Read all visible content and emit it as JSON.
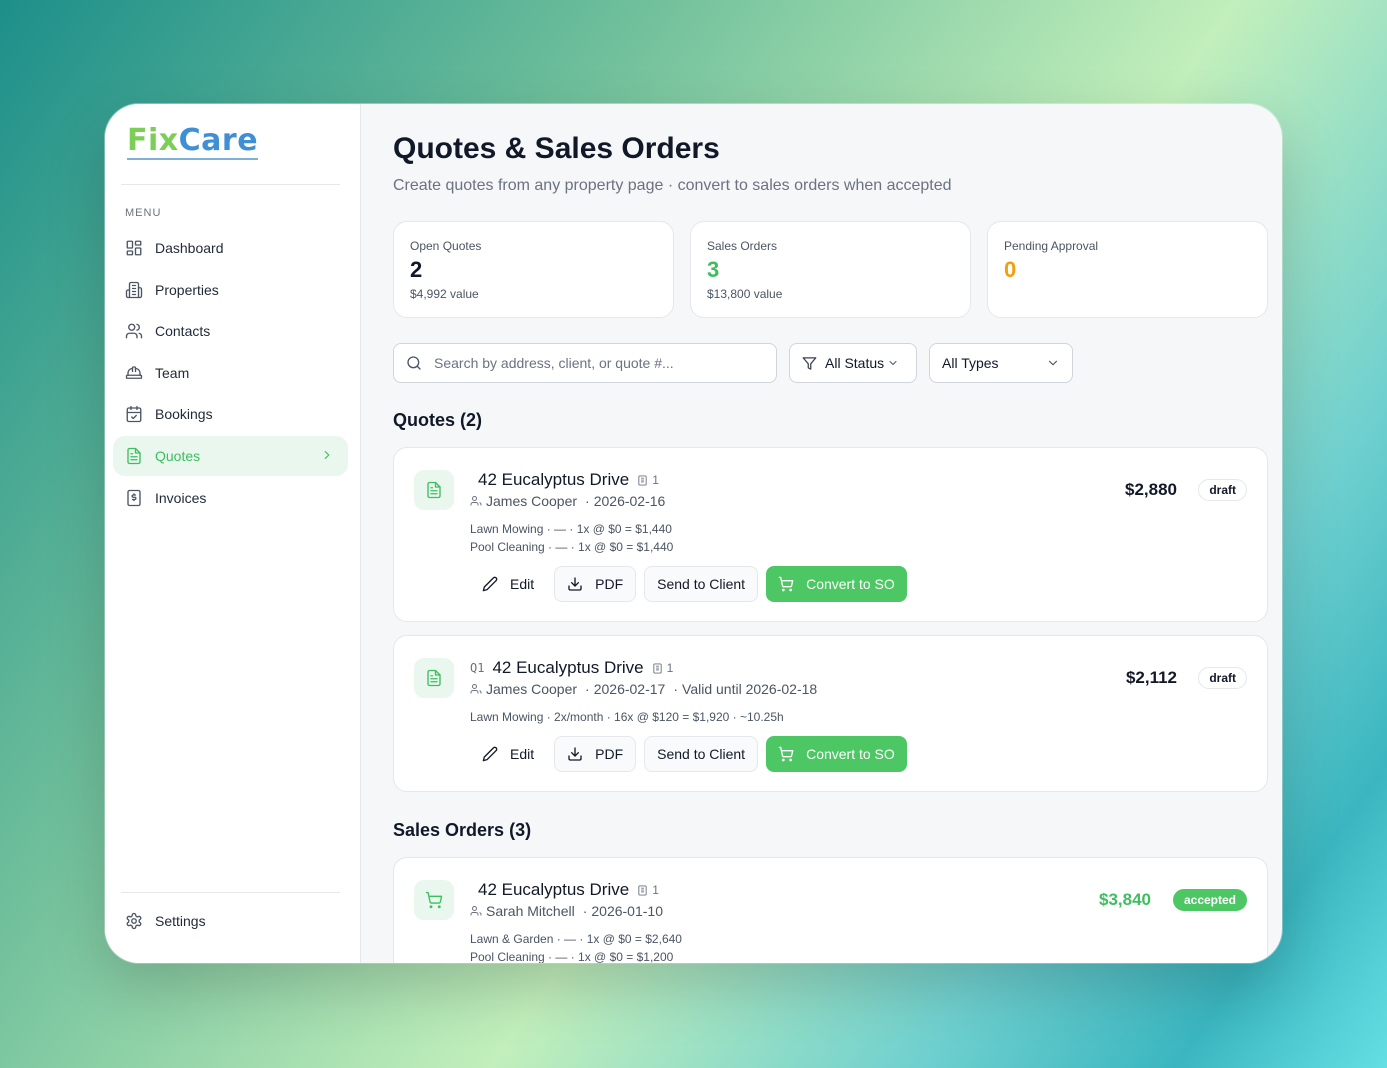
{
  "logo": {
    "part1": "Fix",
    "part2": "Care"
  },
  "sidebar": {
    "menu_label": "MENU",
    "items": [
      {
        "label": "Dashboard",
        "icon": "dashboard-icon"
      },
      {
        "label": "Properties",
        "icon": "building-icon"
      },
      {
        "label": "Contacts",
        "icon": "users-icon"
      },
      {
        "label": "Team",
        "icon": "hardhat-icon"
      },
      {
        "label": "Bookings",
        "icon": "calendar-icon"
      },
      {
        "label": "Quotes",
        "icon": "file-icon",
        "active": true
      },
      {
        "label": "Invoices",
        "icon": "receipt-icon"
      }
    ],
    "settings_label": "Settings"
  },
  "page": {
    "title": "Quotes & Sales Orders",
    "subtitle": "Create quotes from any property page · convert to sales orders when accepted"
  },
  "stats": [
    {
      "label": "Open Quotes",
      "value": "2",
      "sub": "$4,992 value",
      "color": "#111827"
    },
    {
      "label": "Sales Orders",
      "value": "3",
      "sub": "$13,800 value",
      "color": "#3cbf5d"
    },
    {
      "label": "Pending Approval",
      "value": "0",
      "sub": "",
      "color": "#f59e0b"
    }
  ],
  "filters": {
    "search_placeholder": "Search by address, client, or quote #...",
    "status": "All Status",
    "type": "All Types"
  },
  "quotes_section": {
    "title": "Quotes (2)"
  },
  "sales_section": {
    "title": "Sales Orders (3)"
  },
  "buttons": {
    "edit": "Edit",
    "pdf": "PDF",
    "send": "Send to Client",
    "convert": "Convert to SO"
  },
  "quotes": [
    {
      "number": "",
      "address": "42 Eucalyptus Drive",
      "units": "1",
      "client": "James Cooper",
      "date": "2026-02-16",
      "valid": "",
      "lines": [
        "Lawn Mowing · — · 1x @ $0 = $1,440",
        "Pool Cleaning · — · 1x @ $0 = $1,440"
      ],
      "amount": "$2,880",
      "status": "draft"
    },
    {
      "number": "Q1",
      "address": "42 Eucalyptus Drive",
      "units": "1",
      "client": "James Cooper",
      "date": "2026-02-17",
      "valid": "Valid until 2026-02-18",
      "lines": [
        "Lawn Mowing · 2x/month · 16x @ $120 = $1,920 · ~10.25h"
      ],
      "amount": "$2,112",
      "status": "draft"
    }
  ],
  "sales_orders": [
    {
      "address": "42 Eucalyptus Drive",
      "units": "1",
      "client": "Sarah Mitchell",
      "date": "2026-01-10",
      "lines": [
        "Lawn & Garden · — · 1x @ $0 = $2,640",
        "Pool Cleaning · — · 1x @ $0 = $1,200"
      ],
      "amount": "$3,840",
      "status": "accepted"
    }
  ],
  "colors": {
    "accent": "#4cc764",
    "accent_text": "#3cbf5d",
    "warning": "#f59e0b"
  }
}
